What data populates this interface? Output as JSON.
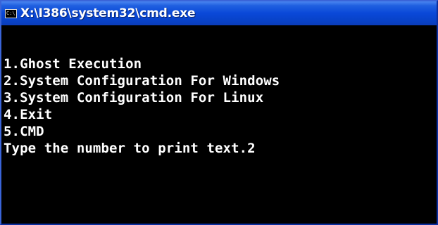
{
  "window": {
    "title": "X:\\I386\\system32\\cmd.exe",
    "app_icon": "cmd-icon",
    "app_icon_glyph": "C:\\",
    "titlebar_color": "#0a48d8",
    "console_bg": "#000000",
    "console_fg": "#ffffff"
  },
  "console": {
    "lines": [
      "1.Ghost Execution",
      "2.System Configuration For Windows",
      "3.System Configuration For Linux",
      "4.Exit",
      "5.CMD",
      "Type the number to print text.2"
    ]
  }
}
